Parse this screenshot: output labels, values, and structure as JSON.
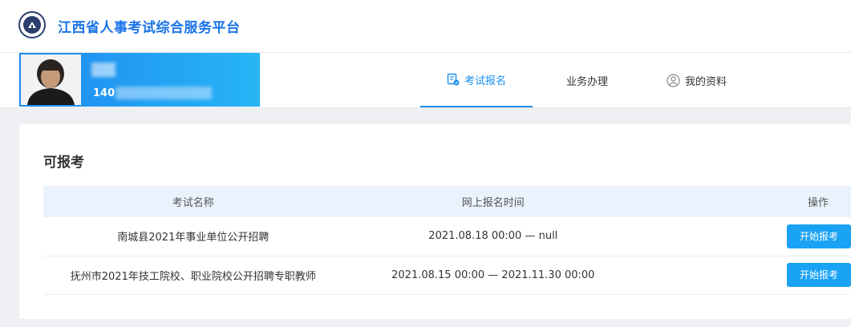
{
  "header": {
    "title": "江西省人事考试综合服务平台"
  },
  "user": {
    "id_prefix": "140"
  },
  "nav": {
    "tabs": [
      {
        "label": "考试报名",
        "active": true,
        "icon": "exam-form-icon"
      },
      {
        "label": "业务办理",
        "active": false
      },
      {
        "label": "我的资料",
        "active": false,
        "icon": "user-icon"
      }
    ]
  },
  "section": {
    "title": "可报考",
    "columns": [
      "考试名称",
      "网上报名时间",
      "操作"
    ],
    "rows": [
      {
        "name": "南城县2021年事业单位公开招聘",
        "time": "2021.08.18 00:00 — null",
        "action": "开始报考"
      },
      {
        "name": "抚州市2021年技工院校、职业院校公开招聘专职教师",
        "time": "2021.08.15 00:00 — 2021.11.30 00:00",
        "action": "开始报考"
      }
    ]
  },
  "colors": {
    "accent": "#1a8ff0",
    "button": "#1aa3f5",
    "header_row": "#eaf3fd"
  }
}
